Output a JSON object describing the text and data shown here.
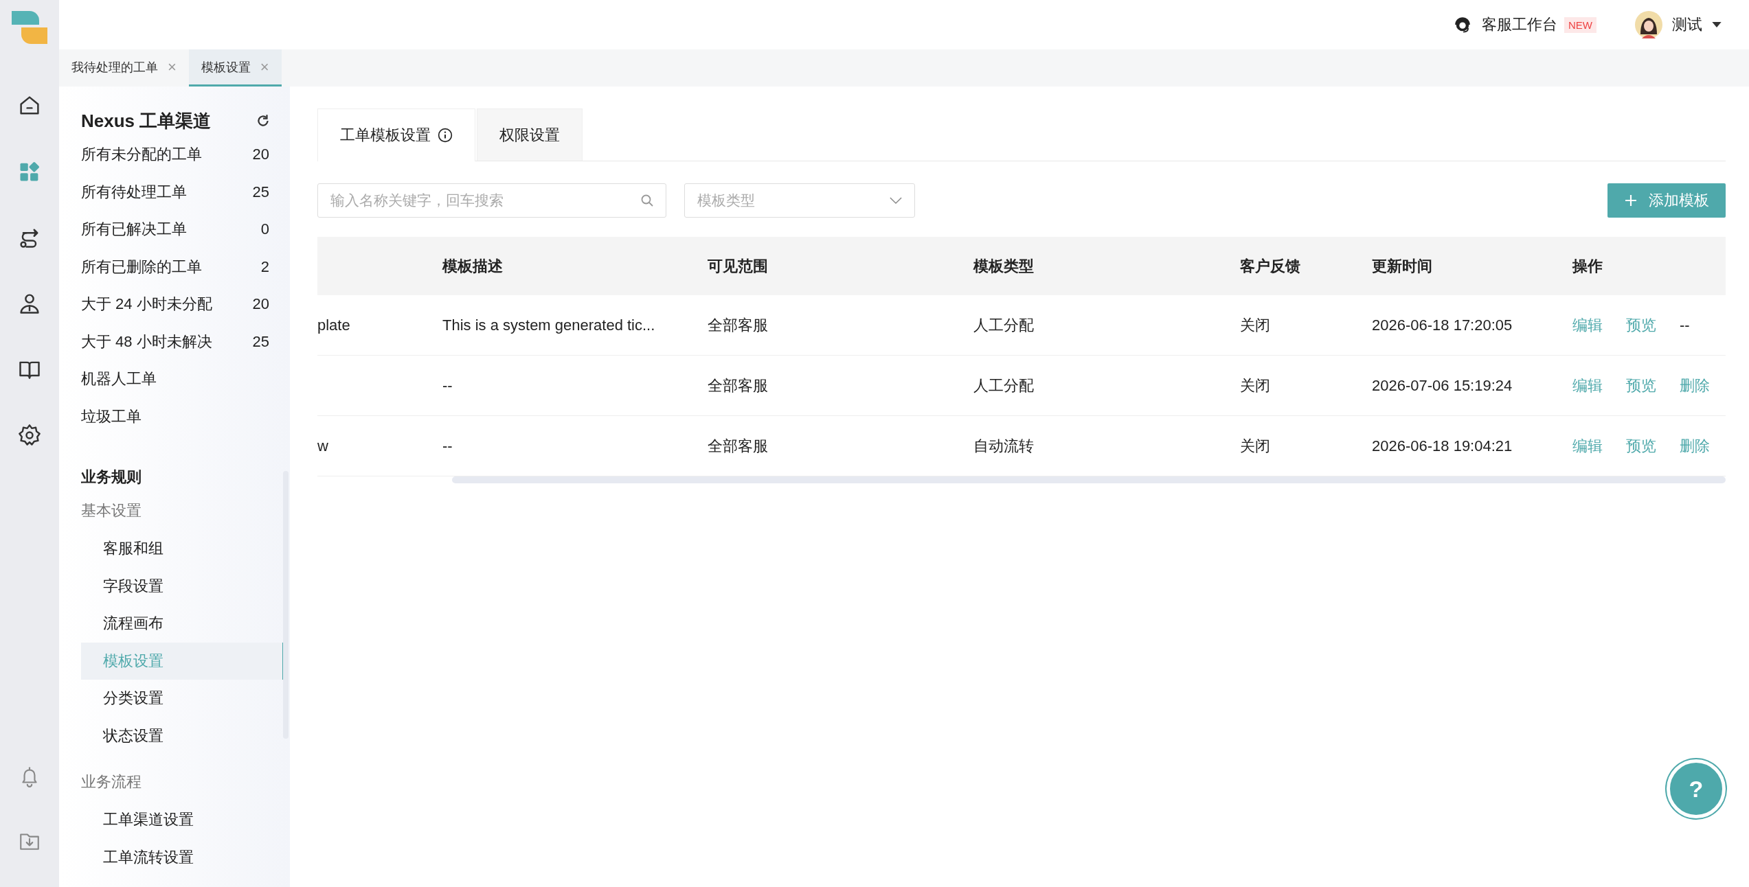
{
  "rail": {
    "items": [
      {
        "kind": "home",
        "selected": false
      },
      {
        "kind": "apps",
        "selected": true
      },
      {
        "kind": "route",
        "selected": false
      },
      {
        "kind": "agent",
        "selected": false
      },
      {
        "kind": "book",
        "selected": false
      },
      {
        "kind": "gear",
        "selected": false
      }
    ],
    "bottom": [
      {
        "kind": "bell"
      },
      {
        "kind": "download"
      }
    ]
  },
  "header": {
    "workbench": "客服工作台",
    "badge": "NEW",
    "user": "测试"
  },
  "page_tabs": [
    {
      "label": "我待处理的工单",
      "selected": false,
      "close": "×"
    },
    {
      "label": "模板设置",
      "selected": true,
      "close": "×"
    }
  ],
  "help_button": "?",
  "sidebar": {
    "title": "Nexus 工单渠道",
    "views": [
      {
        "label": "所有未分配的工单",
        "count": "20"
      },
      {
        "label": "所有待处理工单",
        "count": "25"
      },
      {
        "label": "所有已解决工单",
        "count": "0"
      },
      {
        "label": "所有已删除的工单",
        "count": "2"
      },
      {
        "label": "大于 24 小时未分配",
        "count": "20"
      },
      {
        "label": "大于 48 小时未解决",
        "count": "25"
      },
      {
        "label": "机器人工单"
      },
      {
        "label": "垃圾工单"
      }
    ],
    "section": "业务规则",
    "groups": [
      {
        "title": "基本设置",
        "items": [
          {
            "label": "客服和组",
            "selected": false
          },
          {
            "label": "字段设置",
            "selected": false
          },
          {
            "label": "流程画布",
            "selected": false
          },
          {
            "label": "模板设置",
            "selected": true
          },
          {
            "label": "分类设置",
            "selected": false
          },
          {
            "label": "状态设置",
            "selected": false
          }
        ]
      },
      {
        "title": "业务流程",
        "items": [
          {
            "label": "工单渠道设置",
            "selected": false
          },
          {
            "label": "工单流转设置",
            "selected": false
          }
        ]
      }
    ]
  },
  "content_tabs": [
    {
      "label": "工单模板设置",
      "selected": true,
      "info": true
    },
    {
      "label": "权限设置",
      "selected": false,
      "info": false
    }
  ],
  "search": {
    "placeholder": "输入名称关键字，回车搜索"
  },
  "type_select": {
    "placeholder": "模板类型"
  },
  "add_button": "添加模板",
  "table": {
    "columns": [
      "模板描述",
      "可见范围",
      "模板类型",
      "客户反馈",
      "更新时间",
      "操作"
    ],
    "rows": [
      {
        "column_1": "plate",
        "description": "This is a system generated tic...",
        "scope": "全部客服",
        "type": "人工分配",
        "feedback": "关闭",
        "updated": "2026-06-18 17:20:05",
        "actions": [
          {
            "label": "编辑",
            "kind": "link"
          },
          {
            "label": "预览",
            "kind": "link"
          },
          {
            "label": "--",
            "kind": "text"
          }
        ]
      },
      {
        "description": "--",
        "scope": "全部客服",
        "type": "人工分配",
        "feedback": "关闭",
        "updated": "2026-07-06 15:19:24",
        "actions": [
          {
            "label": "编辑",
            "kind": "link"
          },
          {
            "label": "预览",
            "kind": "link"
          },
          {
            "label": "删除",
            "kind": "link"
          }
        ]
      },
      {
        "column_1": "w",
        "description": "--",
        "scope": "全部客服",
        "type": "自动流转",
        "feedback": "关闭",
        "updated": "2026-06-18 19:04:21",
        "actions": [
          {
            "label": "编辑",
            "kind": "link"
          },
          {
            "label": "预览",
            "kind": "link"
          },
          {
            "label": "删除",
            "kind": "link"
          }
        ]
      }
    ]
  }
}
